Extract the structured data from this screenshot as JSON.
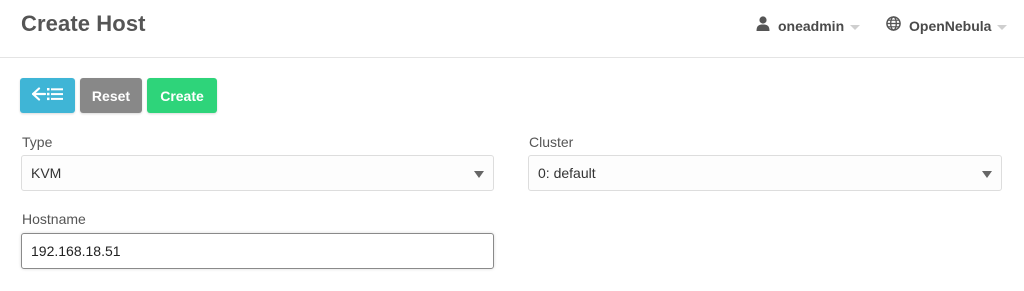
{
  "header": {
    "title": "Create Host",
    "user": {
      "icon": "user-icon",
      "label": "oneadmin"
    },
    "zone": {
      "icon": "globe-icon",
      "label": "OpenNebula"
    }
  },
  "toolbar": {
    "back_icon": "back-to-list-icon",
    "reset_label": "Reset",
    "create_label": "Create"
  },
  "form": {
    "type": {
      "label": "Type",
      "value": "KVM"
    },
    "cluster": {
      "label": "Cluster",
      "value": "0: default"
    },
    "hostname": {
      "label": "Hostname",
      "value": "192.168.18.51"
    }
  },
  "colors": {
    "back_button": "#3fb5d6",
    "reset_button": "#888888",
    "create_button": "#2ed47a"
  }
}
